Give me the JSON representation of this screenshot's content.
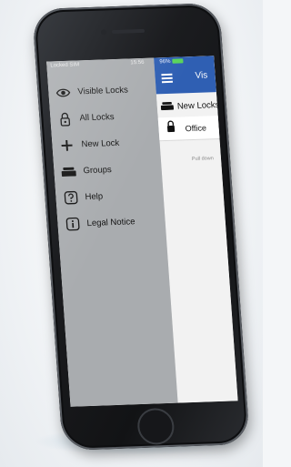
{
  "status_bar": {
    "carrier": "Locked SIM",
    "time": "15:56",
    "battery": "96%"
  },
  "drawer": {
    "items": [
      {
        "label": "Visible Locks",
        "icon": "eye-icon"
      },
      {
        "label": "All Locks",
        "icon": "padlock-outline-icon"
      },
      {
        "label": "New Lock",
        "icon": "plus-icon"
      },
      {
        "label": "Groups",
        "icon": "stack-icon"
      },
      {
        "label": "Help",
        "icon": "question-icon"
      },
      {
        "label": "Legal Notice",
        "icon": "info-icon"
      }
    ]
  },
  "main": {
    "title": "Vis",
    "section_header": "New Locks",
    "locks": [
      {
        "label": "Office",
        "icon": "padlock-icon"
      }
    ],
    "hint": "Pull down"
  },
  "colors": {
    "navbar": "#2f5fb3",
    "drawer_bg": "#a9acaf"
  }
}
